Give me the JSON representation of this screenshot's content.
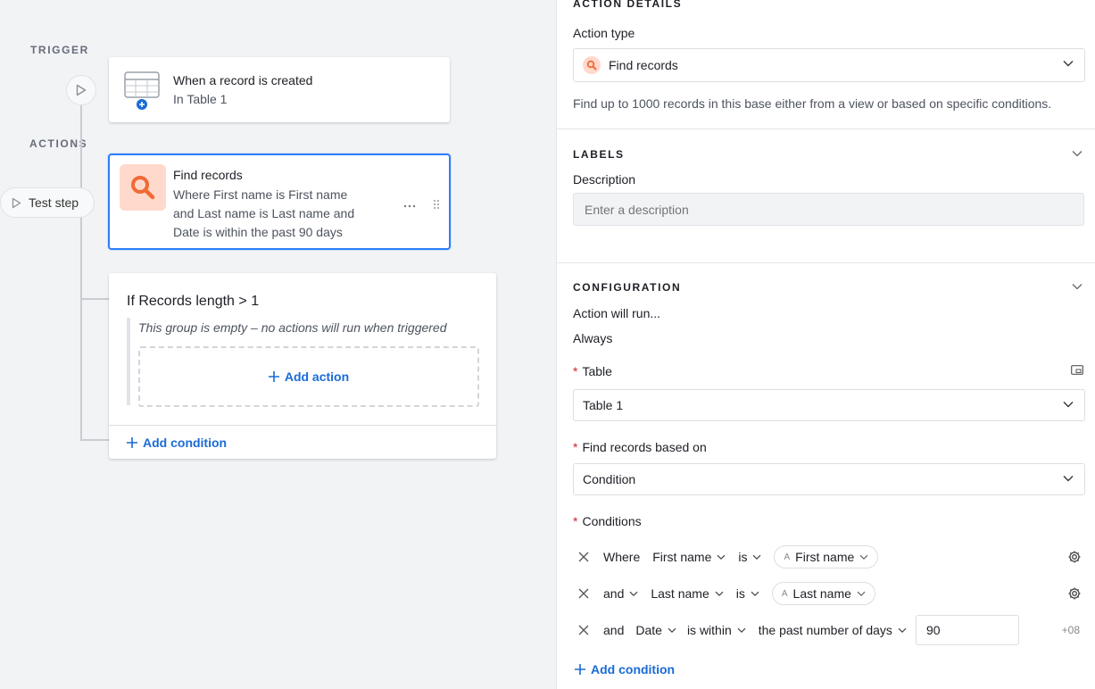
{
  "canvas": {
    "trigger_label": "TRIGGER",
    "actions_label": "ACTIONS",
    "trigger_card": {
      "title": "When a record is created",
      "subtitle": "In Table 1"
    },
    "test_step_label": "Test step",
    "action_card": {
      "title": "Find records",
      "line1": "Where First name is First name",
      "line2": "and Last name is Last name and",
      "line3": "Date is within the past 90 days"
    },
    "group": {
      "title": "If Records length > 1",
      "empty_message": "This group is empty – no actions will run when triggered",
      "add_action_label": "Add action",
      "add_condition_label": "Add condition"
    }
  },
  "panel": {
    "details_header": "ACTION DETAILS",
    "action_type_label": "Action type",
    "action_type_value": "Find records",
    "action_type_description": "Find up to 1000 records in this base either from a view or based on specific conditions.",
    "labels_header": "LABELS",
    "description_label": "Description",
    "description_placeholder": "Enter a description",
    "configuration_header": "CONFIGURATION",
    "run_label": "Action will run...",
    "run_value": "Always",
    "table_label": "Table",
    "table_value": "Table 1",
    "find_based_label": "Find records based on",
    "find_based_value": "Condition",
    "conditions_label": "Conditions",
    "conditions": [
      {
        "conj": "Where",
        "field": "First name",
        "op": "is",
        "value": "First name"
      },
      {
        "conj": "and",
        "field": "Last name",
        "op": "is",
        "value": "Last name"
      },
      {
        "conj": "and",
        "field": "Date",
        "op": "is within",
        "mode": "the past number of days",
        "value": "90",
        "tz": "+08"
      }
    ],
    "add_condition_label": "Add condition"
  },
  "colors": {
    "accent": "#2d7ff9",
    "link": "#1a6bd6",
    "search_tile": "#ffd9cc",
    "search_icon": "#f06a35",
    "required": "#d3202f"
  }
}
